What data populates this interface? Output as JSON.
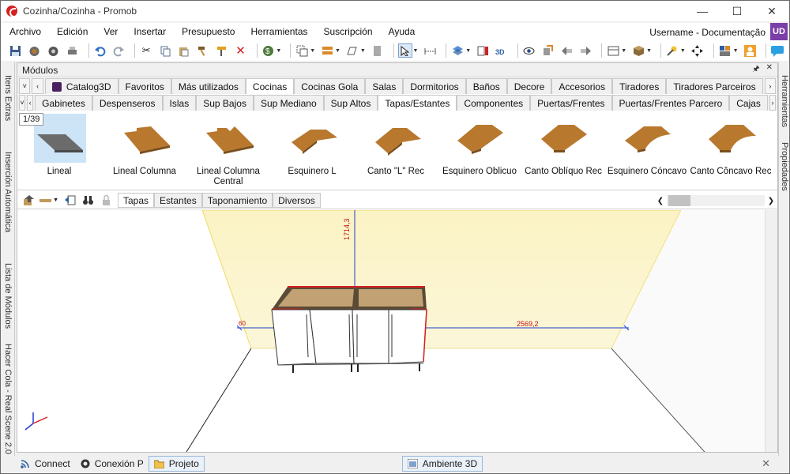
{
  "window": {
    "title": "Cozinha/Cozinha - Promob",
    "minimize": "—",
    "maximize": "☐",
    "close": "✕"
  },
  "menu": {
    "items": [
      "Archivo",
      "Edición",
      "Ver",
      "Insertar",
      "Presupuesto",
      "Herramientas",
      "Suscripción",
      "Ayuda"
    ],
    "user_label": "Username - Documentação",
    "avatar_initials": "UD"
  },
  "left_rail": {
    "tabs": [
      "Itens Extras",
      "Inserción Automática",
      "Lista de Módulos",
      "Hacer Cola - Real Scene 2.0"
    ]
  },
  "right_rail": {
    "tabs": [
      "Herramientas",
      "Propiedades"
    ]
  },
  "panel": {
    "title": "Módulos",
    "pin": "📌",
    "close": "✕",
    "category_tabs": [
      "Catalog3D",
      "Favoritos",
      "Más utilizados",
      "Cocinas",
      "Cocinas Gola",
      "Salas",
      "Dormitorios",
      "Baños",
      "Decore",
      "Accesorios",
      "Tiradores",
      "Tiradores Parceiros"
    ],
    "category_active": "Cocinas",
    "sub_tabs": [
      "Gabinetes",
      "Despenseros",
      "Islas",
      "Sup Bajos",
      "Sup Mediano",
      "Sup Altos",
      "Tapas/Estantes",
      "Componentes",
      "Puertas/Frentes",
      "Puertas/Frentes Parcero",
      "Cajas"
    ],
    "sub_active": "Tapas/Estantes",
    "page_count": "1/39",
    "items": [
      {
        "label": "Lineal",
        "shape": "straight",
        "selected": true
      },
      {
        "label": "Lineal Columna",
        "shape": "notch-left"
      },
      {
        "label": "Lineal Columna Central",
        "shape": "notch-center"
      },
      {
        "label": "Esquinero L",
        "shape": "l-shape"
      },
      {
        "label": "Canto \"L\" Rec",
        "shape": "l-rec"
      },
      {
        "label": "Esquinero Oblicuo",
        "shape": "oblique"
      },
      {
        "label": "Canto Oblíquo Rec",
        "shape": "oblique-rec"
      },
      {
        "label": "Esquinero Cóncavo",
        "shape": "concave"
      },
      {
        "label": "Canto Côncavo Rec",
        "shape": "concave-rec"
      }
    ],
    "view_tabs": [
      "Tapas",
      "Estantes",
      "Taponamiento",
      "Diversos"
    ],
    "view_active": "Tapas"
  },
  "viewport": {
    "dim_height": "1714,3",
    "dim_width": "2569,2",
    "dim_left": "60"
  },
  "statusbar": {
    "connect": "Connect",
    "conexion": "Conexión P",
    "projeto": "Projeto",
    "ambiente": "Ambiente 3D",
    "close": "✕"
  }
}
